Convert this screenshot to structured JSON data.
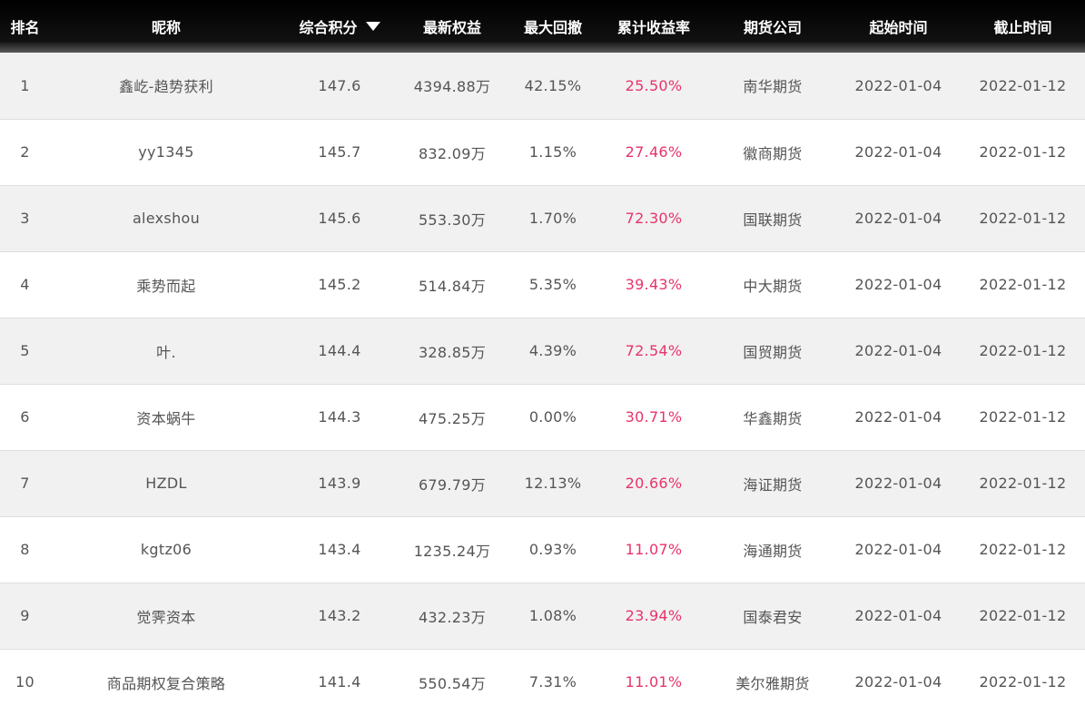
{
  "accent_return_color": "#e8336a",
  "header": {
    "rank": "排名",
    "nickname": "昵称",
    "score": "综合积分",
    "score_sort_icon": "triangle-down-icon",
    "equity": "最新权益",
    "max_drawdown": "最大回撤",
    "cumulative_return": "累计收益率",
    "futures_company": "期货公司",
    "start_date": "起始时间",
    "end_date": "截止时间"
  },
  "rows": [
    {
      "rank": "1",
      "nickname": "鑫屹-趋势获利",
      "score": "147.6",
      "equity": "4394.88万",
      "max_drawdown": "42.15%",
      "cumulative_return": "25.50%",
      "company": "南华期货",
      "start": "2022-01-04",
      "end": "2022-01-12"
    },
    {
      "rank": "2",
      "nickname": "yy1345",
      "score": "145.7",
      "equity": "832.09万",
      "max_drawdown": "1.15%",
      "cumulative_return": "27.46%",
      "company": "徽商期货",
      "start": "2022-01-04",
      "end": "2022-01-12"
    },
    {
      "rank": "3",
      "nickname": "alexshou",
      "score": "145.6",
      "equity": "553.30万",
      "max_drawdown": "1.70%",
      "cumulative_return": "72.30%",
      "company": "国联期货",
      "start": "2022-01-04",
      "end": "2022-01-12"
    },
    {
      "rank": "4",
      "nickname": "乘势而起",
      "score": "145.2",
      "equity": "514.84万",
      "max_drawdown": "5.35%",
      "cumulative_return": "39.43%",
      "company": "中大期货",
      "start": "2022-01-04",
      "end": "2022-01-12"
    },
    {
      "rank": "5",
      "nickname": "叶.",
      "score": "144.4",
      "equity": "328.85万",
      "max_drawdown": "4.39%",
      "cumulative_return": "72.54%",
      "company": "国贸期货",
      "start": "2022-01-04",
      "end": "2022-01-12"
    },
    {
      "rank": "6",
      "nickname": "资本蜗牛",
      "score": "144.3",
      "equity": "475.25万",
      "max_drawdown": "0.00%",
      "cumulative_return": "30.71%",
      "company": "华鑫期货",
      "start": "2022-01-04",
      "end": "2022-01-12"
    },
    {
      "rank": "7",
      "nickname": "HZDL",
      "score": "143.9",
      "equity": "679.79万",
      "max_drawdown": "12.13%",
      "cumulative_return": "20.66%",
      "company": "海证期货",
      "start": "2022-01-04",
      "end": "2022-01-12"
    },
    {
      "rank": "8",
      "nickname": "kgtz06",
      "score": "143.4",
      "equity": "1235.24万",
      "max_drawdown": "0.93%",
      "cumulative_return": "11.07%",
      "company": "海通期货",
      "start": "2022-01-04",
      "end": "2022-01-12"
    },
    {
      "rank": "9",
      "nickname": "觉霁资本",
      "score": "143.2",
      "equity": "432.23万",
      "max_drawdown": "1.08%",
      "cumulative_return": "23.94%",
      "company": "国泰君安",
      "start": "2022-01-04",
      "end": "2022-01-12"
    },
    {
      "rank": "10",
      "nickname": "商品期权复合策略",
      "score": "141.4",
      "equity": "550.54万",
      "max_drawdown": "7.31%",
      "cumulative_return": "11.01%",
      "company": "美尔雅期货",
      "start": "2022-01-04",
      "end": "2022-01-12"
    }
  ]
}
